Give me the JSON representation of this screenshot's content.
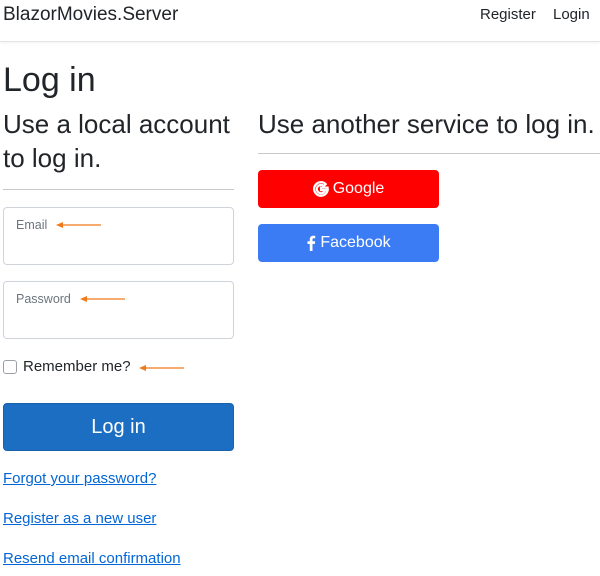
{
  "navbar": {
    "brand": "BlazorMovies.Server",
    "links": [
      {
        "label": "Register"
      },
      {
        "label": "Login"
      }
    ]
  },
  "page": {
    "title": "Log in"
  },
  "local": {
    "heading": "Use a local account to log in.",
    "email_label": "Email",
    "email_value": "",
    "password_label": "Password",
    "password_value": "",
    "remember_label": "Remember me?",
    "remember_checked": false,
    "submit_label": "Log in",
    "links": {
      "forgot": "Forgot your password?",
      "register": "Register as a new user",
      "resend": "Resend email confirmation"
    }
  },
  "external": {
    "heading": "Use another service to log in.",
    "providers": [
      {
        "label": "Google",
        "icon": "google-icon",
        "color": "#ff0000"
      },
      {
        "label": "Facebook",
        "icon": "facebook-icon",
        "color": "#3b7cf5"
      }
    ]
  },
  "colors": {
    "primary": "#1b6ec2",
    "link": "#0366d6",
    "annotation_arrow": "#f07a1a"
  }
}
